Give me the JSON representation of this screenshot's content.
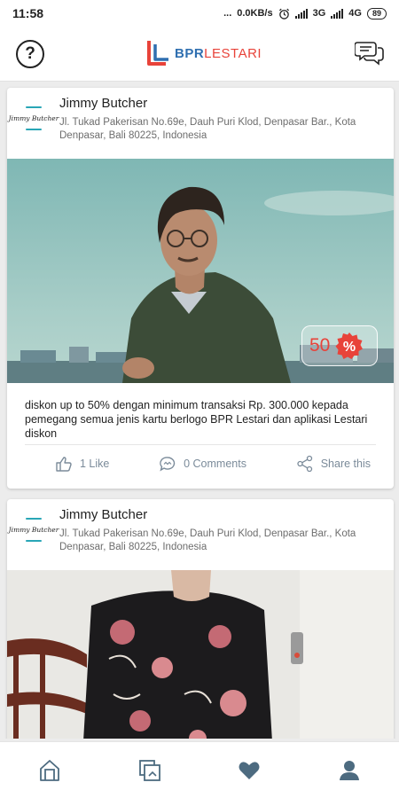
{
  "status_bar": {
    "time": "11:58",
    "dots": "...",
    "network_speed": "0.0KB/s",
    "signal_1": "3G",
    "signal_2": "4G",
    "battery": "89"
  },
  "header": {
    "help_icon": "question-circle-icon",
    "logo_text_part1": "BPR",
    "logo_text_part2": "LESTARI",
    "chat_icon": "chat-bubbles-icon"
  },
  "posts": [
    {
      "author": "Jimmy Butcher",
      "avatar_text": "Jimmy Butcher",
      "address": "Jl. Tukad Pakerisan No.69e, Dauh Puri Klod, Denpasar Bar., Kota Denpasar, Bali 80225, Indonesia",
      "discount_value": "50",
      "discount_icon": "percent-badge-icon",
      "description": "diskon up to 50% dengan minimum transaksi Rp. 300.000 kepada pemegang semua jenis kartu berlogo BPR Lestari dan aplikasi Lestari diskon",
      "like_label": "1 Like",
      "comments_label": "0 Comments",
      "share_label": "Share this"
    },
    {
      "author": "Jimmy Butcher",
      "avatar_text": "Jimmy Butcher",
      "address": "Jl. Tukad Pakerisan No.69e, Dauh Puri Klod, Denpasar Bar., Kota Denpasar, Bali 80225, Indonesia"
    }
  ],
  "bottom_nav": [
    {
      "icon": "home-icon"
    },
    {
      "icon": "gallery-icon"
    },
    {
      "icon": "heart-icon"
    },
    {
      "icon": "profile-icon"
    }
  ],
  "colors": {
    "accent": "#e8433a",
    "brand_blue": "#2f6fb0",
    "nav_icon": "#4d6b80",
    "avatar_line": "#29a6b6"
  }
}
